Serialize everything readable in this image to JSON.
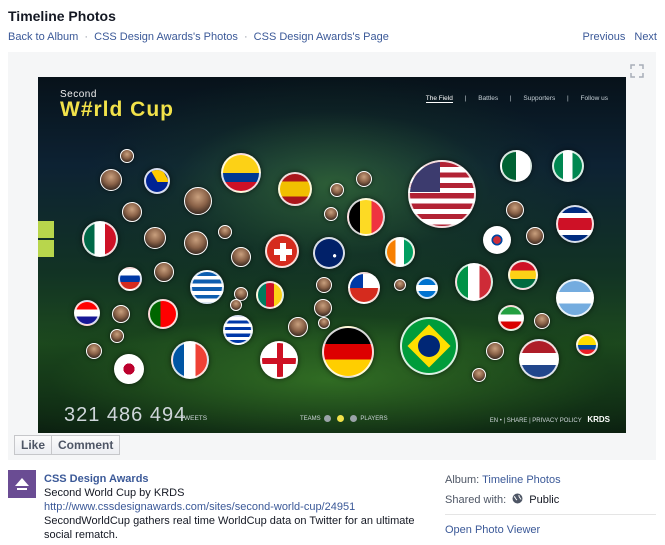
{
  "header": {
    "title": "Timeline Photos",
    "breadcrumb": {
      "back": "Back to Album",
      "sep": "·",
      "album": "CSS Design Awards's Photos",
      "page": "CSS Design Awards's Page"
    },
    "pager": {
      "previous": "Previous",
      "next": "Next"
    }
  },
  "photo": {
    "brand_top": "Second",
    "brand_main": "W#rld Cup",
    "nav": [
      "The Field",
      "|",
      "Battles",
      "|",
      "Supporters",
      "|",
      "Follow us"
    ],
    "counter": "321 486 494",
    "counter_label": "TWEETS",
    "toggle_left": "TEAMS",
    "toggle_right": "PLAYERS",
    "footer_right": "EN  •  |  SHARE  |  PRIVACY POLICY",
    "credit": "KRDS",
    "colors": {
      "accent_yellow": "#f2e24a",
      "tab_green": "#b8d64c"
    }
  },
  "actions": {
    "like": "Like",
    "comment": "Comment"
  },
  "post": {
    "author": "CSS Design Awards",
    "line1": "Second World Cup by KRDS",
    "url": "http://www.cssdesignawards.com/sites/second-world-cup/24951",
    "description": "SecondWorldCup gathers real time WorldCup data on Twitter for an ultimate social rematch."
  },
  "info": {
    "album_label": "Album:",
    "album_value": "Timeline Photos",
    "shared_label": "Shared with:",
    "shared_value": "Public",
    "open_viewer": "Open Photo Viewer"
  }
}
